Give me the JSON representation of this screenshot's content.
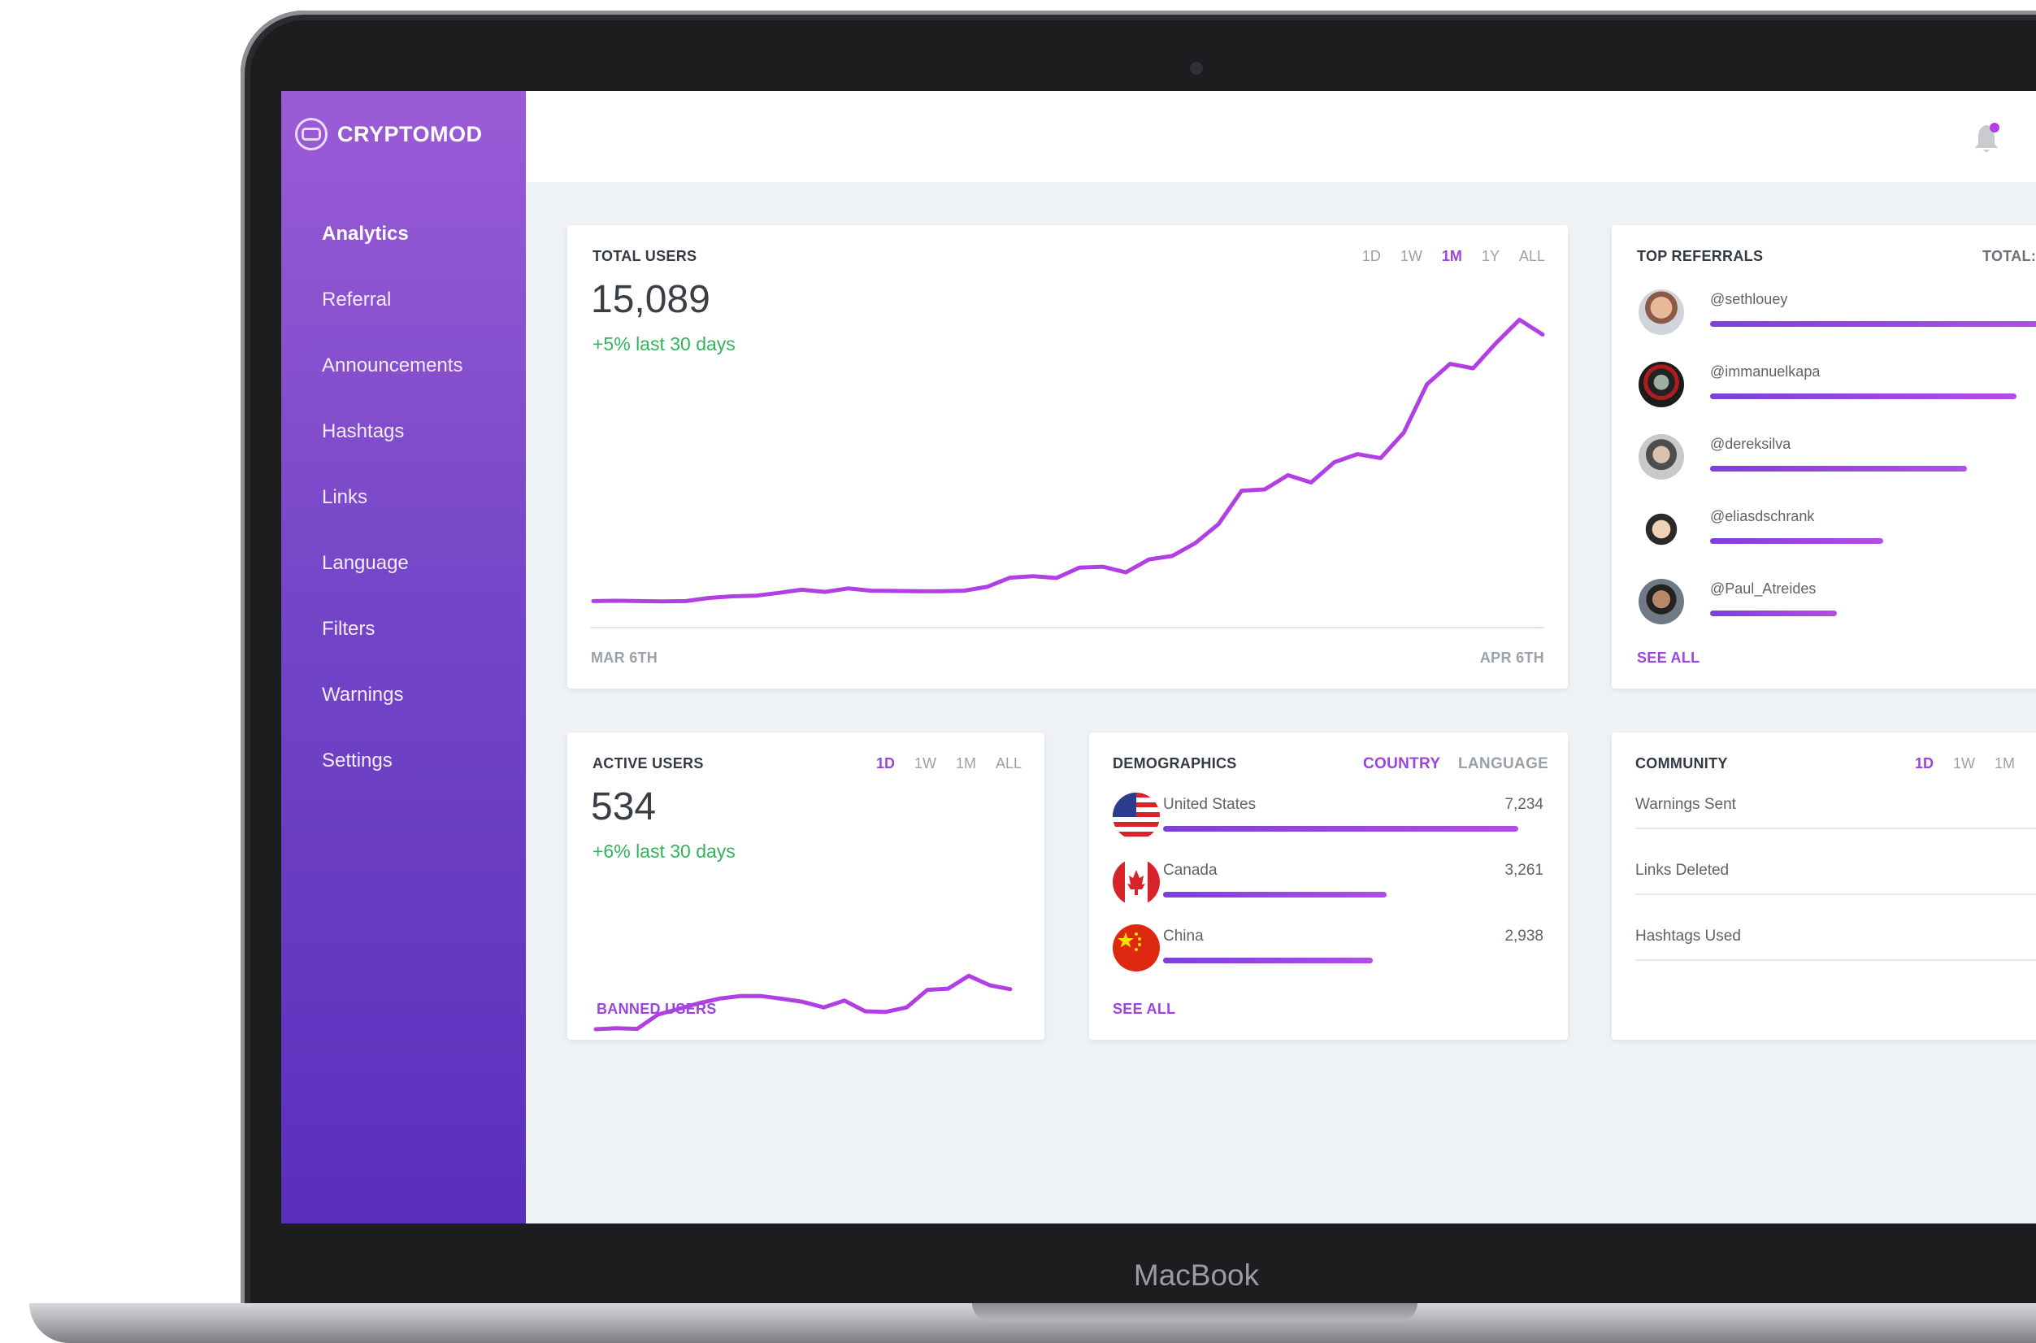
{
  "device": {
    "brand_label": "MacBook"
  },
  "app": {
    "name": "CRYPTOMOD"
  },
  "sidebar": {
    "items": [
      {
        "label": "Analytics",
        "active": true
      },
      {
        "label": "Referral"
      },
      {
        "label": "Announcements"
      },
      {
        "label": "Hashtags"
      },
      {
        "label": "Links"
      },
      {
        "label": "Language"
      },
      {
        "label": "Filters"
      },
      {
        "label": "Warnings"
      },
      {
        "label": "Settings"
      }
    ]
  },
  "topbar": {
    "notification_icon": "bell-icon",
    "has_unread": true
  },
  "colors": {
    "accent": "#9a45de",
    "positive": "#35b35a",
    "sidebar_top": "#9b5bd6",
    "sidebar_bottom": "#5a2fbc"
  },
  "total_users": {
    "title": "TOTAL USERS",
    "value": "15,089",
    "delta": "+5% last 30 days",
    "ranges": [
      "1D",
      "1W",
      "1M",
      "1Y",
      "ALL"
    ],
    "selected_range": "1M",
    "x_start": "MAR 6TH",
    "x_end": "APR 6TH"
  },
  "top_referrals": {
    "title": "TOP REFERRALS",
    "total_label": "TOTAL:",
    "see_all": "SEE ALL",
    "items": [
      {
        "handle": "@sethlouey",
        "fraction": 1.0
      },
      {
        "handle": "@immanuelkapa",
        "fraction": 0.92
      },
      {
        "handle": "@dereksilva",
        "fraction": 0.77
      },
      {
        "handle": "@eliasdschrank",
        "fraction": 0.52
      },
      {
        "handle": "@Paul_Atreides",
        "fraction": 0.38
      }
    ]
  },
  "active_users": {
    "title": "ACTIVE USERS",
    "value": "534",
    "delta": "+6% last 30 days",
    "ranges": [
      "1D",
      "1W",
      "1M",
      "ALL"
    ],
    "selected_range": "1D",
    "link": "BANNED USERS"
  },
  "demographics": {
    "title": "DEMOGRAPHICS",
    "tabs": [
      "COUNTRY",
      "LANGUAGE"
    ],
    "selected_tab": "COUNTRY",
    "see_all": "SEE ALL",
    "countries": [
      {
        "name": "United States",
        "value": "7,234",
        "fraction": 1.0,
        "flag": "us-flag-icon"
      },
      {
        "name": "Canada",
        "value": "3,261",
        "fraction": 0.63,
        "flag": "canada-flag-icon"
      },
      {
        "name": "China",
        "value": "2,938",
        "fraction": 0.59,
        "flag": "china-flag-icon"
      }
    ]
  },
  "community": {
    "title": "COMMUNITY",
    "ranges": [
      "1D",
      "1W",
      "1M"
    ],
    "selected_range": "1D",
    "stats": [
      "Warnings Sent",
      "Links Deleted",
      "Hashtags Used"
    ]
  },
  "chart_data": [
    {
      "type": "line",
      "title": "TOTAL USERS",
      "x_start_label": "MAR 6TH",
      "x_end_label": "APR 6TH",
      "y": [
        3.0,
        3.1,
        3.0,
        2.9,
        3.0,
        4.0,
        4.5,
        4.7,
        5.6,
        6.6,
        5.9,
        7.0,
        6.3,
        6.2,
        6.1,
        6.1,
        6.3,
        7.5,
        10.4,
        10.9,
        10.3,
        13.6,
        13.9,
        12.1,
        16.2,
        17.3,
        21.4,
        27.4,
        38.0,
        38.4,
        42.9,
        40.6,
        47.0,
        49.6,
        48.3,
        56.4,
        71.7,
        78.2,
        76.8,
        84.9,
        92.2,
        87.5
      ]
    },
    {
      "type": "line",
      "title": "ACTIVE USERS",
      "y": [
        6.8,
        7.4,
        7.0,
        15.0,
        18.2,
        21.4,
        24.0,
        25.4,
        25.3,
        23.8,
        22.1,
        19.0,
        22.8,
        16.8,
        16.5,
        19.0,
        28.8,
        29.5,
        36.7,
        31.4,
        29.2
      ]
    }
  ]
}
